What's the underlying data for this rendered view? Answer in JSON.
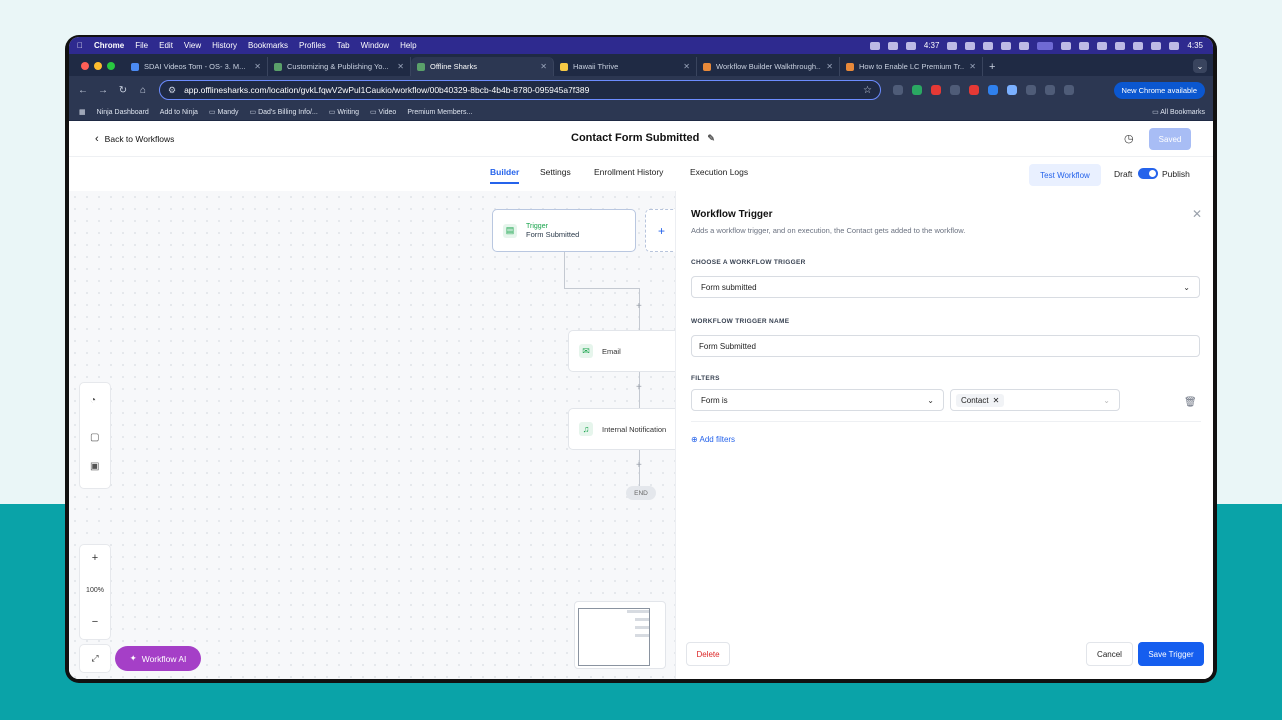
{
  "menubar": {
    "apple": "",
    "items": [
      "Chrome",
      "File",
      "Edit",
      "View",
      "History",
      "Bookmarks",
      "Profiles",
      "Tab",
      "Window",
      "Help"
    ],
    "timer": "4:37",
    "clock": "4:35"
  },
  "tabs": [
    {
      "label": "SDAI Videos Tom - OS- 3. M...",
      "active": false
    },
    {
      "label": "Customizing & Publishing Yo...",
      "active": false
    },
    {
      "label": "Offline Sharks",
      "active": true
    },
    {
      "label": "Hawaii Thrive",
      "active": false
    },
    {
      "label": "Workflow Builder Walkthrough...",
      "active": false
    },
    {
      "label": "How to Enable LC Premium Tr...",
      "active": false
    }
  ],
  "address": {
    "url": "app.offlinesharks.com/location/gvkLfqwV2wPul1Caukio/workflow/00b40329-8bcb-4b4b-8780-095945a7f389",
    "new_chrome": "New Chrome available"
  },
  "bookmarks": {
    "items": [
      "Ninja Dashboard",
      "Add to Ninja",
      "Mandy",
      "Dad's Billing Info/...",
      "Writing",
      "Video",
      "Premium Members..."
    ],
    "all": "All Bookmarks"
  },
  "header": {
    "back": "Back to Workflows",
    "title": "Contact Form Submitted",
    "saved": "Saved"
  },
  "subtabs": [
    "Builder",
    "Settings",
    "Enrollment History",
    "Execution Logs"
  ],
  "controls": {
    "test_workflow": "Test Workflow",
    "draft": "Draft",
    "publish": "Publish"
  },
  "canvas": {
    "trigger_label": "Trigger",
    "trigger_name": "Form Submitted",
    "add": "+",
    "email": "Email",
    "notification": "Internal Notification",
    "end": "END",
    "zoom": "100%",
    "workflow_ai": "Workflow AI"
  },
  "panel": {
    "title": "Workflow Trigger",
    "description": "Adds a workflow trigger, and on execution, the Contact gets added to the workflow.",
    "choose_label": "CHOOSE A WORKFLOW TRIGGER",
    "choose_value": "Form submitted",
    "name_label": "WORKFLOW TRIGGER NAME",
    "name_value": "Form Submitted",
    "filters_label": "FILTERS",
    "filter_field": "Form is",
    "filter_value": "Contact",
    "add_filters": "Add filters",
    "delete": "Delete",
    "cancel": "Cancel",
    "save": "Save Trigger"
  },
  "colors": {
    "accent": "#2563eb",
    "menubar": "#2e2a8f",
    "teal_bg": "#0aa3a8",
    "workflow_ai": "#a53fc7"
  }
}
